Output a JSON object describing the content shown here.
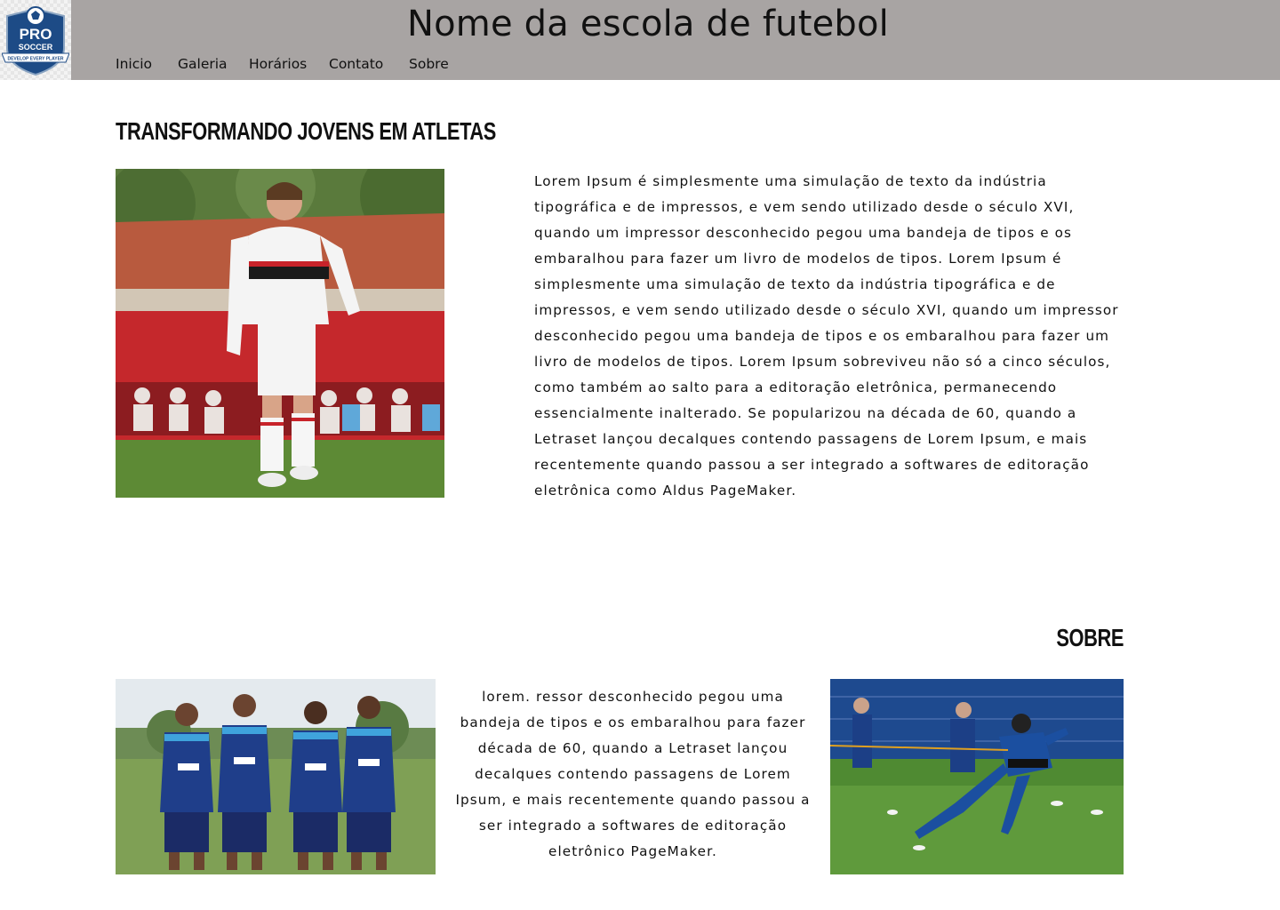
{
  "header": {
    "title": "Nome da escola de futebol",
    "logo": {
      "line1": "PRO",
      "line2": "SOCCER",
      "tagline": "DEVELOP EVERY PLAYER"
    },
    "nav": [
      {
        "label": "Inicio"
      },
      {
        "label": "Galeria"
      },
      {
        "label": "Horários"
      },
      {
        "label": "Contato"
      },
      {
        "label": "Sobre"
      }
    ]
  },
  "hero": {
    "heading": "TRANSFORMANDO JOVENS EM ATLETAS",
    "image": "youth-player-photo",
    "text": "Lorem Ipsum é simplesmente uma simulação de texto da indústria tipográfica e de impressos, e vem sendo utilizado desde o século XVI, quando um impressor desconhecido pegou uma bandeja de tipos e os embaralhou para fazer um livro de modelos de tipos. Lorem Ipsum é simplesmente uma simulação de texto da indústria tipográfica e de impressos, e vem sendo utilizado desde o século XVI, quando um impressor desconhecido pegou uma bandeja de tipos e os embaralhou para fazer um livro de modelos de tipos. Lorem Ipsum sobreviveu não só a cinco séculos, como também ao salto para a editoração eletrônica, permanecendo essencialmente inalterado. Se popularizou na década de 60, quando a Letraset lançou decalques contendo passagens de Lorem Ipsum, e mais recentemente quando passou a ser integrado a softwares de editoração eletrônica como Aldus PageMaker."
  },
  "about": {
    "heading": "SOBRE",
    "text": "lorem. ressor desconhecido pegou uma bandeja de tipos e os embaralhou para fazer  década de 60, quando a Letraset lançou decalques contendo passagens de Lorem Ipsum, e mais recentemente quando passou a ser integrado a softwares de editoração eletrônico PageMaker.",
    "image_left": "team-players-photo",
    "image_right": "training-sprint-photo"
  },
  "colors": {
    "header_bg": "#a8a4a3",
    "text": "#111111",
    "background": "#ffffff"
  }
}
